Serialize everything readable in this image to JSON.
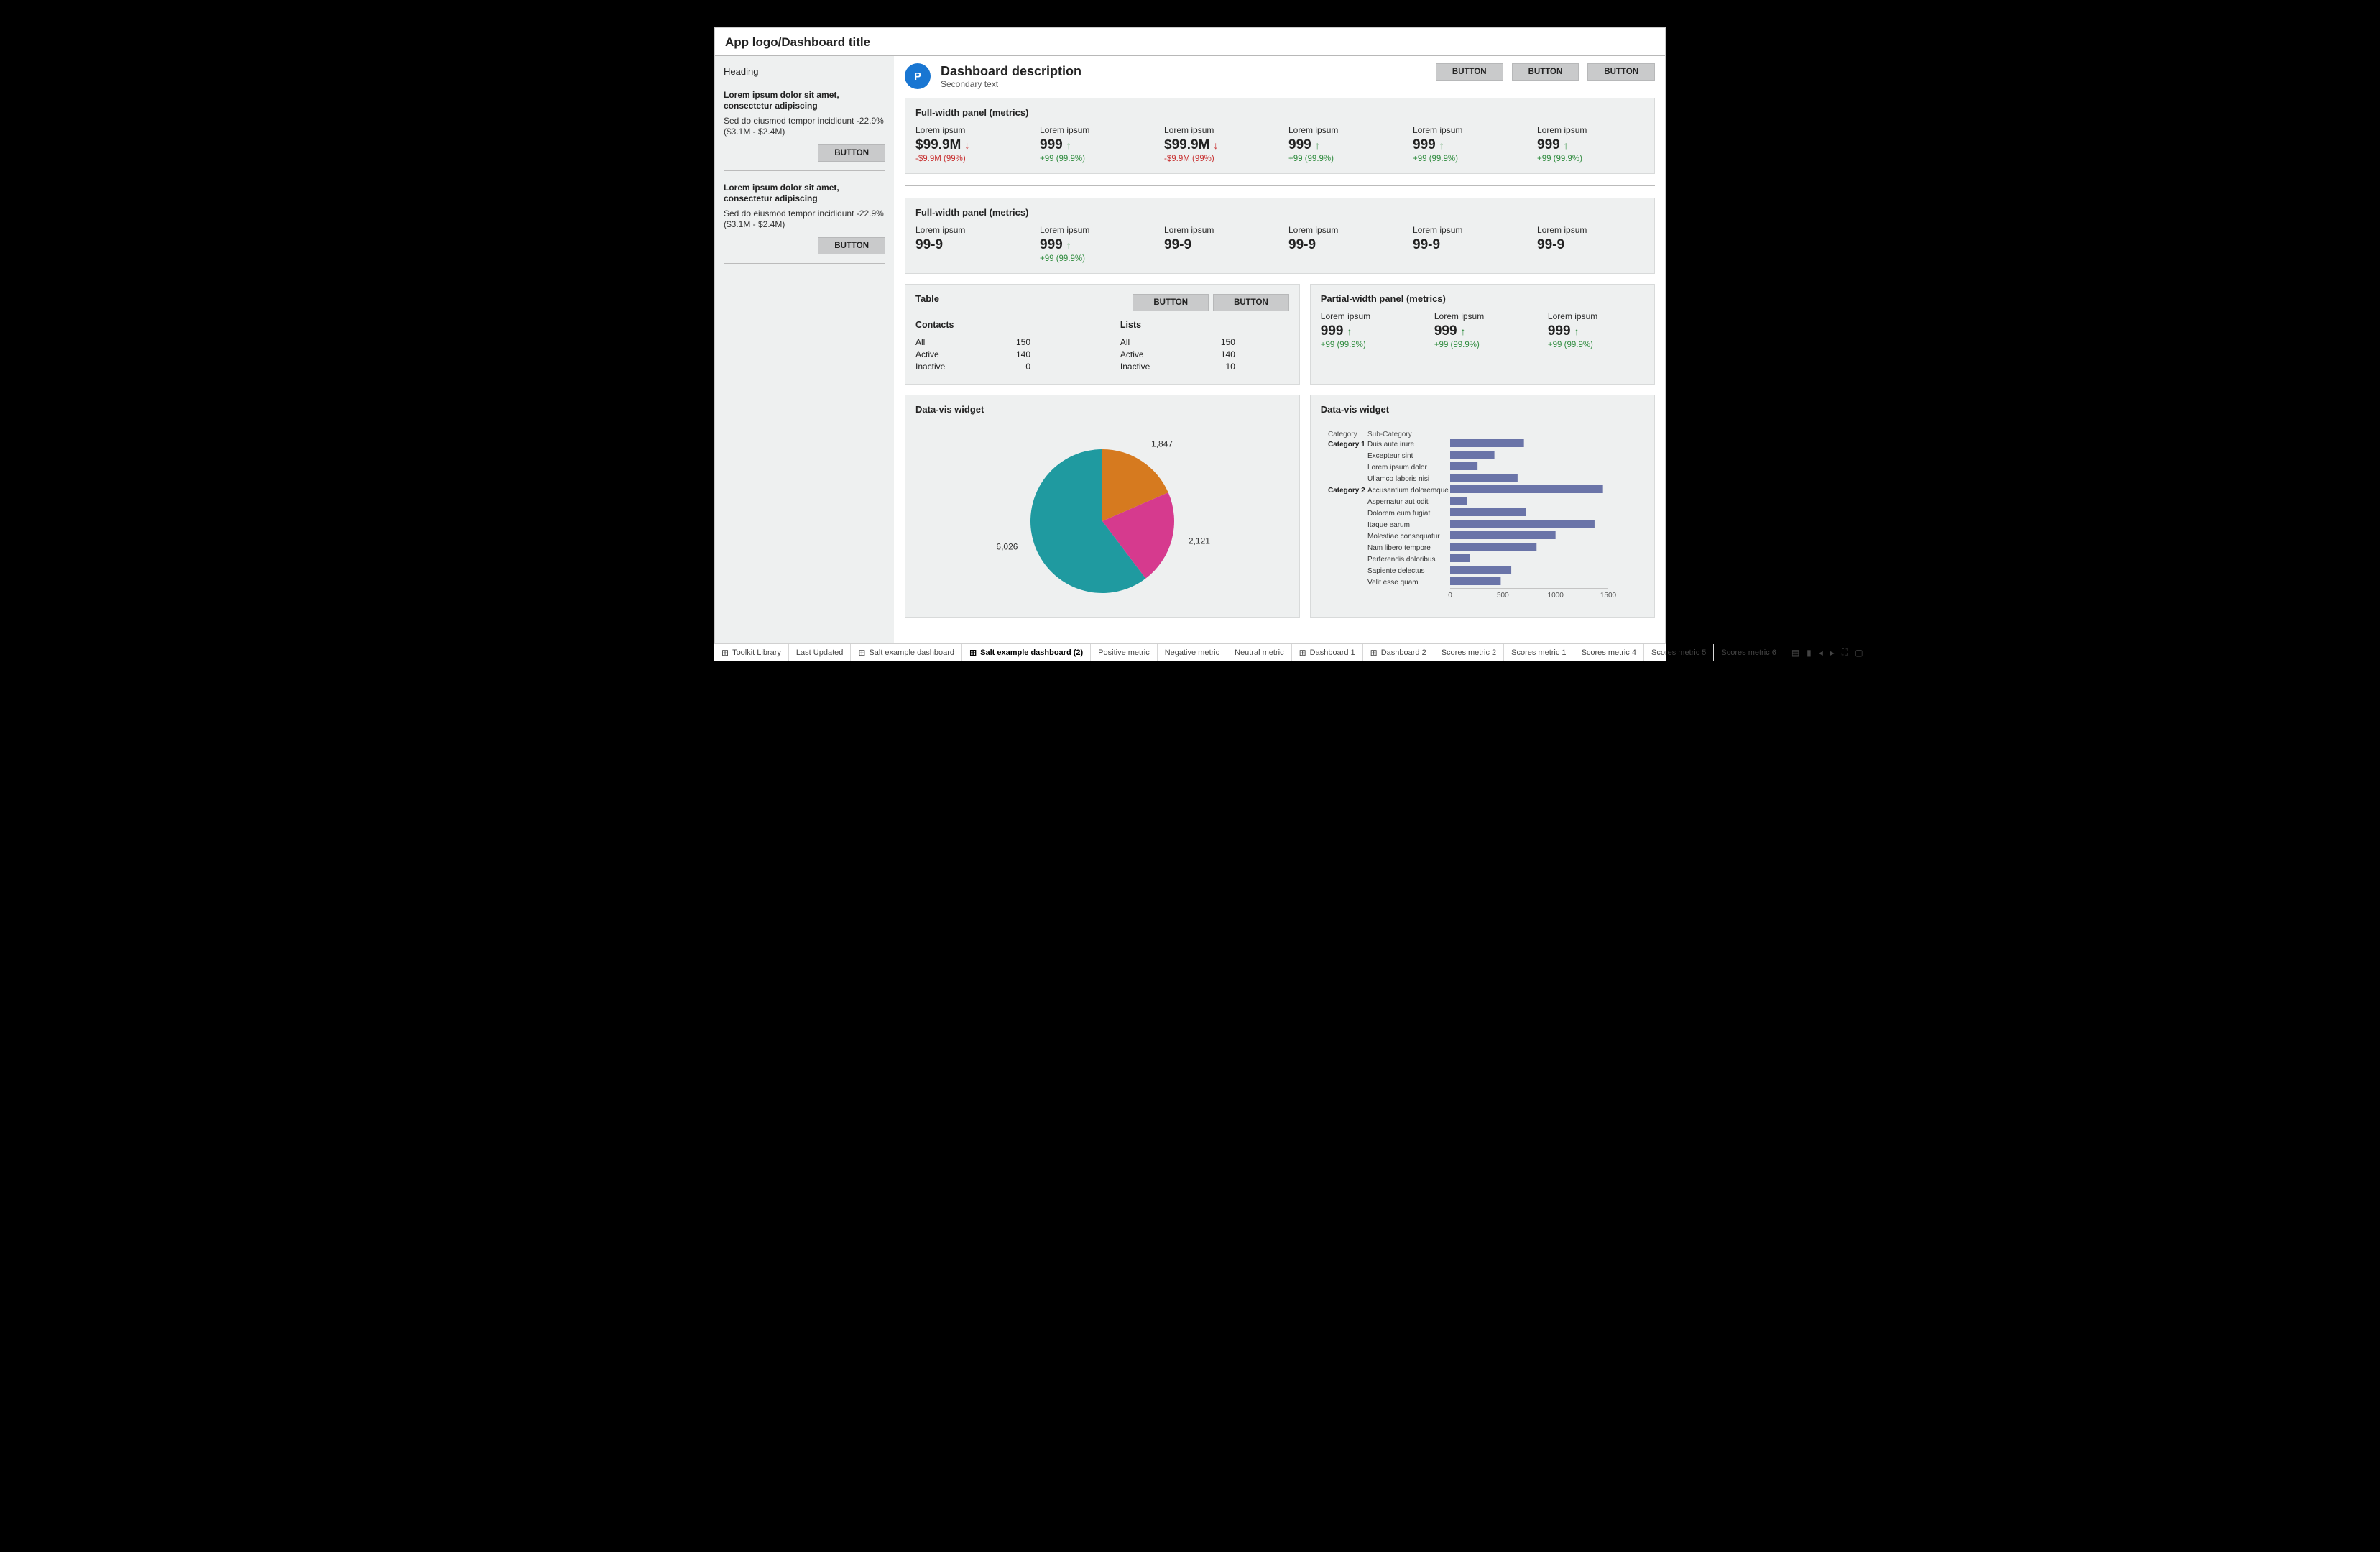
{
  "app_title": "App logo/Dashboard title",
  "sidebar": {
    "heading": "Heading",
    "items": [
      {
        "title": "Lorem ipsum dolor sit amet, consectetur adipiscing",
        "desc": "Sed do eiusmod tempor incididunt -22.9% ($3.1M - $2.4M)",
        "button": "BUTTON"
      },
      {
        "title": "Lorem ipsum dolor sit amet, consectetur adipiscing",
        "desc": "Sed do eiusmod tempor incididunt -22.9% ($3.1M - $2.4M)",
        "button": "BUTTON"
      }
    ]
  },
  "header": {
    "avatar_letter": "P",
    "title": "Dashboard description",
    "subtitle": "Secondary text",
    "buttons": [
      "BUTTON",
      "BUTTON",
      "BUTTON"
    ]
  },
  "panel_metrics_1": {
    "title": "Full-width panel (metrics)",
    "metrics": [
      {
        "label": "Lorem ipsum",
        "value": "$99.9M",
        "dir": "down",
        "sub": "-$9.9M (99%)",
        "tone": "neg"
      },
      {
        "label": "Lorem ipsum",
        "value": "999",
        "dir": "up",
        "sub": "+99 (99.9%)",
        "tone": "pos"
      },
      {
        "label": "Lorem ipsum",
        "value": "$99.9M",
        "dir": "down",
        "sub": "-$9.9M (99%)",
        "tone": "neg"
      },
      {
        "label": "Lorem ipsum",
        "value": "999",
        "dir": "up",
        "sub": "+99 (99.9%)",
        "tone": "pos"
      },
      {
        "label": "Lorem ipsum",
        "value": "999",
        "dir": "up",
        "sub": "+99 (99.9%)",
        "tone": "pos"
      },
      {
        "label": "Lorem ipsum",
        "value": "999",
        "dir": "up",
        "sub": "+99 (99.9%)",
        "tone": "pos"
      }
    ]
  },
  "panel_metrics_2": {
    "title": "Full-width panel (metrics)",
    "metrics": [
      {
        "label": "Lorem ipsum",
        "value": "99-9"
      },
      {
        "label": "Lorem ipsum",
        "value": "999",
        "dir": "up",
        "sub": "+99 (99.9%)",
        "tone": "pos"
      },
      {
        "label": "Lorem ipsum",
        "value": "99-9"
      },
      {
        "label": "Lorem ipsum",
        "value": "99-9"
      },
      {
        "label": "Lorem ipsum",
        "value": "99-9"
      },
      {
        "label": "Lorem ipsum",
        "value": "99-9"
      }
    ]
  },
  "table_panel": {
    "title": "Table",
    "buttons": [
      "BUTTON",
      "BUTTON"
    ],
    "columns": [
      {
        "heading": "Contacts",
        "rows": [
          [
            "All",
            "150"
          ],
          [
            "Active",
            "140"
          ],
          [
            "Inactive",
            "0"
          ]
        ]
      },
      {
        "heading": "Lists",
        "rows": [
          [
            "All",
            "150"
          ],
          [
            "Active",
            "140"
          ],
          [
            "Inactive",
            "10"
          ]
        ]
      }
    ]
  },
  "partial_panel": {
    "title": "Partial-width panel (metrics)",
    "metrics": [
      {
        "label": "Lorem ipsum",
        "value": "999",
        "dir": "up",
        "sub": "+99 (99.9%)",
        "tone": "pos"
      },
      {
        "label": "Lorem ipsum",
        "value": "999",
        "dir": "up",
        "sub": "+99 (99.9%)",
        "tone": "pos"
      },
      {
        "label": "Lorem ipsum",
        "value": "999",
        "dir": "up",
        "sub": "+99 (99.9%)",
        "tone": "pos"
      }
    ]
  },
  "widget_pie": {
    "title": "Data-vis widget"
  },
  "widget_bar": {
    "title": "Data-vis widget",
    "col_headers": [
      "Category",
      "Sub-Category"
    ]
  },
  "chart_data": [
    {
      "type": "pie",
      "title": "Data-vis widget",
      "slices": [
        {
          "label": "1,847",
          "value": 1847,
          "color": "#d67a1f"
        },
        {
          "label": "2,121",
          "value": 2121,
          "color": "#d63a8e"
        },
        {
          "label": "6,026",
          "value": 6026,
          "color": "#1f9aa0"
        }
      ]
    },
    {
      "type": "bar",
      "orientation": "horizontal",
      "title": "Data-vis widget",
      "xlabel": "",
      "ylabel": "",
      "xlim": [
        0,
        1500
      ],
      "xticks": [
        0,
        500,
        1000,
        1500
      ],
      "bar_color": "#6a74a8",
      "groups": [
        {
          "category": "Category 1",
          "rows": [
            {
              "label": "Duis aute irure",
              "value": 700
            },
            {
              "label": "Excepteur sint",
              "value": 420
            },
            {
              "label": "Lorem ipsum dolor",
              "value": 260
            },
            {
              "label": "Ullamco laboris nisi",
              "value": 640
            }
          ]
        },
        {
          "category": "Category 2",
          "rows": [
            {
              "label": "Accusantium doloremque",
              "value": 1450
            },
            {
              "label": "Aspernatur aut odit",
              "value": 160
            },
            {
              "label": "Dolorem eum fugiat",
              "value": 720
            },
            {
              "label": "Itaque earum",
              "value": 1370
            },
            {
              "label": "Molestiae consequatur",
              "value": 1000
            },
            {
              "label": "Nam libero tempore",
              "value": 820
            },
            {
              "label": "Perferendis doloribus",
              "value": 190
            },
            {
              "label": "Sapiente delectus",
              "value": 580
            },
            {
              "label": "Velit esse quam",
              "value": 480
            }
          ]
        }
      ]
    }
  ],
  "bottom_tabs": [
    {
      "label": "Toolkit Library",
      "icon": true
    },
    {
      "label": "Last Updated",
      "icon": false
    },
    {
      "label": "Salt example dashboard",
      "icon": true
    },
    {
      "label": "Salt example dashboard (2)",
      "icon": true,
      "active": true
    },
    {
      "label": "Positive metric",
      "icon": false
    },
    {
      "label": "Negative metric",
      "icon": false
    },
    {
      "label": "Neutral metric",
      "icon": false
    },
    {
      "label": "Dashboard 1",
      "icon": true
    },
    {
      "label": "Dashboard 2",
      "icon": true
    },
    {
      "label": "Scores metric 2",
      "icon": false
    },
    {
      "label": "Scores metric 1",
      "icon": false
    },
    {
      "label": "Scores metric 4",
      "icon": false
    },
    {
      "label": "Scores metric 5",
      "icon": false
    },
    {
      "label": "Scores metric 6",
      "icon": false
    }
  ]
}
